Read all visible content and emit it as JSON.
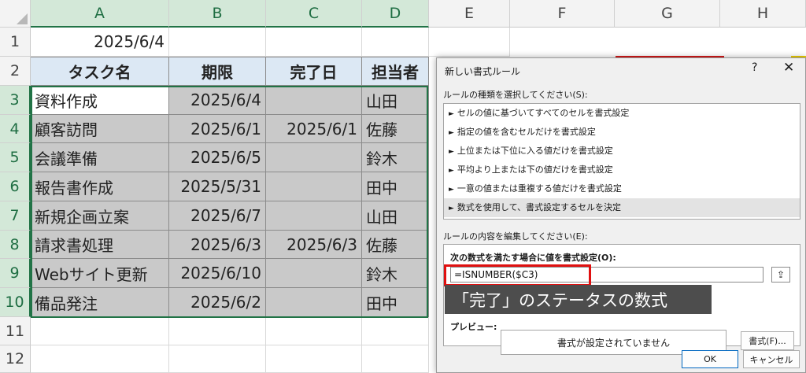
{
  "columns": [
    "A",
    "B",
    "C",
    "D",
    "E",
    "F",
    "G",
    "H"
  ],
  "rows": [
    "1",
    "2",
    "3",
    "4",
    "5",
    "6",
    "7",
    "8",
    "9",
    "10",
    "11",
    "12"
  ],
  "cell_a1": "2025/6/4",
  "table": {
    "headers": [
      "タスク名",
      "期限",
      "完了日",
      "担当者"
    ],
    "rows": [
      {
        "task": "資料作成",
        "due": "2025/6/4",
        "done": "",
        "owner": "山田"
      },
      {
        "task": "顧客訪問",
        "due": "2025/6/1",
        "done": "2025/6/1",
        "owner": "佐藤"
      },
      {
        "task": "会議準備",
        "due": "2025/6/5",
        "done": "",
        "owner": "鈴木"
      },
      {
        "task": "報告書作成",
        "due": "2025/5/31",
        "done": "",
        "owner": "田中"
      },
      {
        "task": "新規企画立案",
        "due": "2025/6/7",
        "done": "",
        "owner": "山田"
      },
      {
        "task": "請求書処理",
        "due": "2025/6/3",
        "done": "2025/6/3",
        "owner": "佐藤"
      },
      {
        "task": "Webサイト更新",
        "due": "2025/6/10",
        "done": "",
        "owner": "鈴木"
      },
      {
        "task": "備品発注",
        "due": "2025/6/2",
        "done": "",
        "owner": "田中"
      }
    ]
  },
  "dialog": {
    "title": "新しい書式ルール",
    "help": "?",
    "close": "✕",
    "select_label": "ルールの種類を選択してください(S):",
    "rule_types": [
      "セルの値に基づいてすべてのセルを書式設定",
      "指定の値を含むセルだけを書式設定",
      "上位または下位に入る値だけを書式設定",
      "平均より上または下の値だけを書式設定",
      "一意の値または重複する値だけを書式設定",
      "数式を使用して、書式設定するセルを決定"
    ],
    "rule_arrow": "►",
    "edit_label": "ルールの内容を編集してください(E):",
    "formula_label": "次の数式を満たす場合に値を書式設定(O):",
    "formula_value": "=ISNUMBER($C3)",
    "collapse_icon": "⇪",
    "preview_label": "プレビュー:",
    "preview_text": "書式が設定されていません",
    "format_button": "書式(F)...",
    "ok_button": "OK",
    "cancel_button": "キャンセル"
  },
  "annotation": "「完了」のステータスの数式",
  "colors": {
    "header_fill": "#dce8f4",
    "formatted_fill": "#c9c9c9",
    "selection": "#217346",
    "highlight_box": "#e01010",
    "annotation_bg": "#4d4d4d"
  }
}
